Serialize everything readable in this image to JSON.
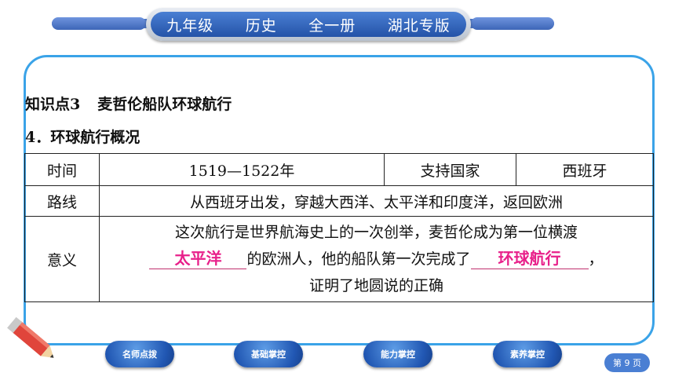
{
  "header": {
    "items": [
      "九年级",
      "历史",
      "全一册",
      "湖北专版"
    ]
  },
  "content": {
    "knowledge_point": "知识点3",
    "knowledge_title": "麦哲伦船队环球航行",
    "section": "4．环球航行概况",
    "table": {
      "row1": [
        "时间",
        "1519—1522年",
        "支持国家",
        "西班牙"
      ],
      "row2": [
        "路线",
        "从西班牙出发，穿越大西洋、太平洋和印度洋，返回欧洲"
      ],
      "row3_label": "意义",
      "row3_text": {
        "line1": "这次航行是世界航海史上的一次创举，麦哲伦成为第一位横渡",
        "answer1": "太平洋",
        "mid": "的欧洲人，他的船队第一次完成了",
        "answer2": "环球航行",
        "end": "，",
        "line3": "证明了地圆说的正确"
      }
    }
  },
  "nav": {
    "buttons": [
      "名师点拨",
      "基础掌控",
      "能力掌控",
      "素养掌控"
    ],
    "page": "第 9 页"
  },
  "colors": {
    "accent": "#3aa3e8",
    "header_blue": "#2453a8",
    "answer_magenta": "#e8208a"
  }
}
